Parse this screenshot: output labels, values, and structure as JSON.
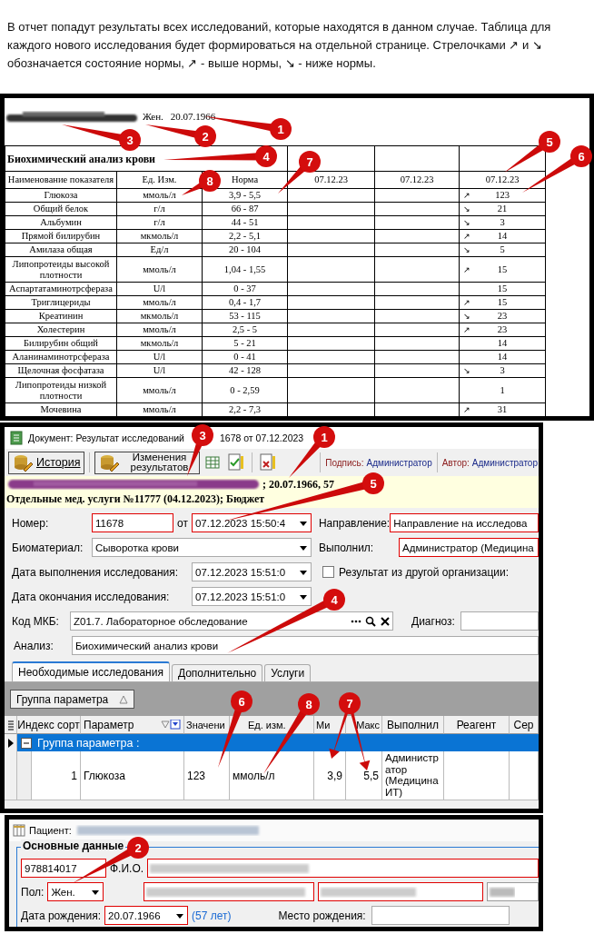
{
  "intro": "В отчет попадут результаты всех исследований, которые находятся в данном случае. Таблица для каждого нового исследования будет формироваться на отдельной странице. Стрелочками ↗ и ↘ обозначается состояние нормы, ↗ - выше нормы, ↘ - ниже нормы.",
  "report": {
    "patient": {
      "sex": "Жен.",
      "birth_date": "20.07.1966"
    },
    "title": "Биохимический анализ крови",
    "columns": [
      "Наименование показателя",
      "Ед. Изм.",
      "Норма",
      "07.12.23",
      "07.12.23",
      "07.12.23"
    ],
    "rows": [
      {
        "name": "Глюкоза",
        "unit": "ммоль/л",
        "norm": "3,9 - 5,5",
        "arrow": "↗",
        "value": "123"
      },
      {
        "name": "Общий белок",
        "unit": "г/л",
        "norm": "66 - 87",
        "arrow": "↘",
        "value": "21"
      },
      {
        "name": "Альбумин",
        "unit": "г/л",
        "norm": "44 - 51",
        "arrow": "↘",
        "value": "3"
      },
      {
        "name": "Прямой билирубин",
        "unit": "мкмоль/л",
        "norm": "2,2 - 5,1",
        "arrow": "↗",
        "value": "14"
      },
      {
        "name": "Амилаза общая",
        "unit": "Ед/л",
        "norm": "20 - 104",
        "arrow": "↘",
        "value": "5"
      },
      {
        "name": "Липопротеиды высокой плотности",
        "unit": "ммоль/л",
        "norm": "1,04 - 1,55",
        "arrow": "↗",
        "value": "15"
      },
      {
        "name": "Аспартатаминотрсфераза",
        "unit": "U/l",
        "norm": "0 - 37",
        "value": "15"
      },
      {
        "name": "Триглицериды",
        "unit": "ммоль/л",
        "norm": "0,4 - 1,7",
        "arrow": "↗",
        "value": "15"
      },
      {
        "name": "Креатинин",
        "unit": "мкмоль/л",
        "norm": "53 - 115",
        "arrow": "↘",
        "value": "23"
      },
      {
        "name": "Холестерин",
        "unit": "ммоль/л",
        "norm": "2,5 - 5",
        "arrow": "↗",
        "value": "23"
      },
      {
        "name": "Билирубин общий",
        "unit": "мкмоль/л",
        "norm": "5 - 21",
        "value": "14"
      },
      {
        "name": "Аланинаминотрсфераза",
        "unit": "U/l",
        "norm": "0 - 41",
        "value": "14"
      },
      {
        "name": "Щелочная фосфатаза",
        "unit": "U/l",
        "norm": "42 - 128",
        "arrow": "↘",
        "value": "3"
      },
      {
        "name": "Липопротеиды низкой плотности",
        "unit": "ммоль/л",
        "norm": "0 - 2,59",
        "value": "1"
      },
      {
        "name": "Мочевина",
        "unit": "ммоль/л",
        "norm": "2,2 - 7,3",
        "arrow": "↗",
        "value": "31"
      }
    ],
    "callouts": [
      {
        "number": "1"
      },
      {
        "number": "2"
      },
      {
        "number": "3"
      },
      {
        "number": "4"
      },
      {
        "number": "5"
      },
      {
        "number": "6"
      },
      {
        "number": "7"
      },
      {
        "number": "8"
      }
    ]
  },
  "document_window": {
    "title_start": "Документ: Результат исследований",
    "title_end": "1678 от 07.12.2023",
    "toolbar": {
      "history_button": "История",
      "changes_button": "Изменения результатов",
      "signature_label": "Подпись:",
      "signature_value": "Администратор",
      "author_label": "Автор:",
      "author_value": "Администратор"
    },
    "info_bar": {
      "line_1": "; 20.07.1966, 57",
      "line_2": "Отдельные мед. услуги №11777 (04.12.2023); Бюджет"
    },
    "form": {
      "number": {
        "label": "Номер:",
        "value": "11678",
        "required": true
      },
      "date": {
        "label": "от",
        "value": "07.12.2023 15:50:4",
        "required": true
      },
      "direction": {
        "label": "Направление:",
        "value": "Направление на исследова",
        "required": true
      },
      "biomaterial": {
        "label": "Биоматериал:",
        "value": "Сыворотка крови",
        "required": false
      },
      "performer": {
        "label": "Выполнил:",
        "value": "Администратор (Медицина",
        "required": true
      },
      "exec_date": {
        "label": "Дата выполнения исследования:",
        "value": "07.12.2023 15:51:0",
        "required": false
      },
      "other_org": {
        "label": "Результат из другой организации:",
        "checked": false
      },
      "end_date": {
        "label": "Дата окончания исследования:",
        "value": "07.12.2023 15:51:0",
        "required": false
      },
      "icd": {
        "label": "Код МКБ:",
        "value": "Z01.7. Лабораторное обследование",
        "required": false
      },
      "diagnosis": {
        "label": "Диагноз:",
        "required": false
      },
      "analysis": {
        "label": "Анализ:",
        "value": "Биохимический анализ крови",
        "required": false
      }
    },
    "tabs": [
      {
        "label": "Необходимые исследования",
        "selected": true
      },
      {
        "label": "Дополнительно",
        "selected": false
      },
      {
        "label": "Услуги",
        "selected": false
      }
    ],
    "group_chip": "Группа параметра",
    "grid": {
      "columns": [
        "Индекс сорт",
        "Параметр",
        "Значени",
        "Ед. изм.",
        "Ми",
        "Макс",
        "Выполнил",
        "Реагент",
        "Сер"
      ],
      "group_row": "Группа параметра :",
      "rows": [
        {
          "index": "1",
          "parameter": "Глюкоза",
          "value": "123",
          "unit": "ммоль/л",
          "min": "3,9",
          "max": "5,5",
          "performer": "Администратор (Медицина ИТ)"
        }
      ]
    },
    "callouts": [
      {
        "number": "3"
      },
      {
        "number": "1"
      },
      {
        "number": "5"
      },
      {
        "number": "4"
      },
      {
        "number": "6"
      },
      {
        "number": "8"
      },
      {
        "number": "7"
      }
    ]
  },
  "patient_window": {
    "title": "Пациент:",
    "section": "Основные данные",
    "id_field": "978814017",
    "fio_label": "Ф.И.О.",
    "sex_label": "Пол:",
    "sex": "Жен.",
    "birth_label": "Дата рождения:",
    "birth_date": "20.07.1966",
    "age": "(57 лет)",
    "birthplace_label": "Место рождения:",
    "callouts": [
      {
        "number": "2"
      }
    ]
  }
}
